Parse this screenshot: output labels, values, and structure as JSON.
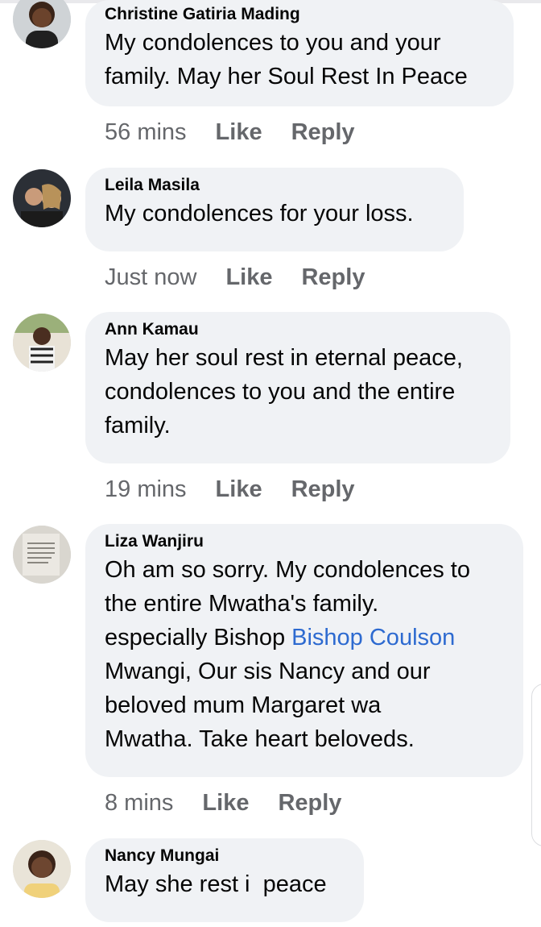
{
  "comments": [
    {
      "author": "Christine Gatiria Mading",
      "lines": [
        "My condolences to you and your",
        "family. May her Soul Rest In Peace"
      ],
      "time": "56 mins"
    },
    {
      "author": "Leila Masila",
      "lines": [
        "My condolences for your loss."
      ],
      "time": "Just now"
    },
    {
      "author": "Ann Kamau",
      "lines": [
        "May her soul rest in eternal peace,",
        "condolences to you and the entire",
        "family."
      ],
      "time": "19 mins"
    },
    {
      "author": "Liza Wanjiru",
      "lines": [
        "Oh am so sorry. My condolences to",
        "the entire Mwatha's family."
      ],
      "line3_pre": "especially Bishop ",
      "mention": "Bishop Coulson",
      "lines_after": [
        "Mwangi, Our sis Nancy and our",
        "beloved mum Margaret wa",
        "Mwatha. Take heart beloveds."
      ],
      "time": "8 mins"
    },
    {
      "author": "Nancy Mungai",
      "lines": [
        "May she rest i  peace"
      ]
    }
  ],
  "actions": {
    "like": "Like",
    "reply": "Reply"
  },
  "colors": {
    "bubble": "#f0f2f5",
    "mention": "#2d6ad0",
    "meta": "#65676b"
  },
  "icons": {
    "avatar": "profile-photo"
  }
}
